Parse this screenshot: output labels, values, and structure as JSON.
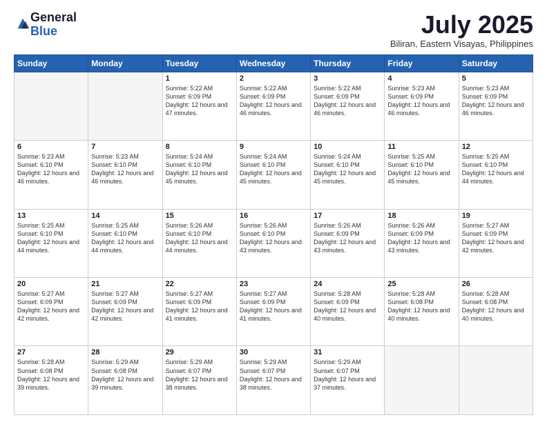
{
  "header": {
    "logo_general": "General",
    "logo_blue": "Blue",
    "month_title": "July 2025",
    "location": "Biliran, Eastern Visayas, Philippines"
  },
  "weekdays": [
    "Sunday",
    "Monday",
    "Tuesday",
    "Wednesday",
    "Thursday",
    "Friday",
    "Saturday"
  ],
  "weeks": [
    [
      {
        "day": "",
        "info": ""
      },
      {
        "day": "",
        "info": ""
      },
      {
        "day": "1",
        "info": "Sunrise: 5:22 AM\nSunset: 6:09 PM\nDaylight: 12 hours and 47 minutes."
      },
      {
        "day": "2",
        "info": "Sunrise: 5:22 AM\nSunset: 6:09 PM\nDaylight: 12 hours and 46 minutes."
      },
      {
        "day": "3",
        "info": "Sunrise: 5:22 AM\nSunset: 6:09 PM\nDaylight: 12 hours and 46 minutes."
      },
      {
        "day": "4",
        "info": "Sunrise: 5:23 AM\nSunset: 6:09 PM\nDaylight: 12 hours and 46 minutes."
      },
      {
        "day": "5",
        "info": "Sunrise: 5:23 AM\nSunset: 6:09 PM\nDaylight: 12 hours and 46 minutes."
      }
    ],
    [
      {
        "day": "6",
        "info": "Sunrise: 5:23 AM\nSunset: 6:10 PM\nDaylight: 12 hours and 46 minutes."
      },
      {
        "day": "7",
        "info": "Sunrise: 5:23 AM\nSunset: 6:10 PM\nDaylight: 12 hours and 46 minutes."
      },
      {
        "day": "8",
        "info": "Sunrise: 5:24 AM\nSunset: 6:10 PM\nDaylight: 12 hours and 45 minutes."
      },
      {
        "day": "9",
        "info": "Sunrise: 5:24 AM\nSunset: 6:10 PM\nDaylight: 12 hours and 45 minutes."
      },
      {
        "day": "10",
        "info": "Sunrise: 5:24 AM\nSunset: 6:10 PM\nDaylight: 12 hours and 45 minutes."
      },
      {
        "day": "11",
        "info": "Sunrise: 5:25 AM\nSunset: 6:10 PM\nDaylight: 12 hours and 45 minutes."
      },
      {
        "day": "12",
        "info": "Sunrise: 5:25 AM\nSunset: 6:10 PM\nDaylight: 12 hours and 44 minutes."
      }
    ],
    [
      {
        "day": "13",
        "info": "Sunrise: 5:25 AM\nSunset: 6:10 PM\nDaylight: 12 hours and 44 minutes."
      },
      {
        "day": "14",
        "info": "Sunrise: 5:25 AM\nSunset: 6:10 PM\nDaylight: 12 hours and 44 minutes."
      },
      {
        "day": "15",
        "info": "Sunrise: 5:26 AM\nSunset: 6:10 PM\nDaylight: 12 hours and 44 minutes."
      },
      {
        "day": "16",
        "info": "Sunrise: 5:26 AM\nSunset: 6:10 PM\nDaylight: 12 hours and 43 minutes."
      },
      {
        "day": "17",
        "info": "Sunrise: 5:26 AM\nSunset: 6:09 PM\nDaylight: 12 hours and 43 minutes."
      },
      {
        "day": "18",
        "info": "Sunrise: 5:26 AM\nSunset: 6:09 PM\nDaylight: 12 hours and 43 minutes."
      },
      {
        "day": "19",
        "info": "Sunrise: 5:27 AM\nSunset: 6:09 PM\nDaylight: 12 hours and 42 minutes."
      }
    ],
    [
      {
        "day": "20",
        "info": "Sunrise: 5:27 AM\nSunset: 6:09 PM\nDaylight: 12 hours and 42 minutes."
      },
      {
        "day": "21",
        "info": "Sunrise: 5:27 AM\nSunset: 6:09 PM\nDaylight: 12 hours and 42 minutes."
      },
      {
        "day": "22",
        "info": "Sunrise: 5:27 AM\nSunset: 6:09 PM\nDaylight: 12 hours and 41 minutes."
      },
      {
        "day": "23",
        "info": "Sunrise: 5:27 AM\nSunset: 6:09 PM\nDaylight: 12 hours and 41 minutes."
      },
      {
        "day": "24",
        "info": "Sunrise: 5:28 AM\nSunset: 6:09 PM\nDaylight: 12 hours and 40 minutes."
      },
      {
        "day": "25",
        "info": "Sunrise: 5:28 AM\nSunset: 6:08 PM\nDaylight: 12 hours and 40 minutes."
      },
      {
        "day": "26",
        "info": "Sunrise: 5:28 AM\nSunset: 6:08 PM\nDaylight: 12 hours and 40 minutes."
      }
    ],
    [
      {
        "day": "27",
        "info": "Sunrise: 5:28 AM\nSunset: 6:08 PM\nDaylight: 12 hours and 39 minutes."
      },
      {
        "day": "28",
        "info": "Sunrise: 5:29 AM\nSunset: 6:08 PM\nDaylight: 12 hours and 39 minutes."
      },
      {
        "day": "29",
        "info": "Sunrise: 5:29 AM\nSunset: 6:07 PM\nDaylight: 12 hours and 38 minutes."
      },
      {
        "day": "30",
        "info": "Sunrise: 5:29 AM\nSunset: 6:07 PM\nDaylight: 12 hours and 38 minutes."
      },
      {
        "day": "31",
        "info": "Sunrise: 5:29 AM\nSunset: 6:07 PM\nDaylight: 12 hours and 37 minutes."
      },
      {
        "day": "",
        "info": ""
      },
      {
        "day": "",
        "info": ""
      }
    ]
  ]
}
